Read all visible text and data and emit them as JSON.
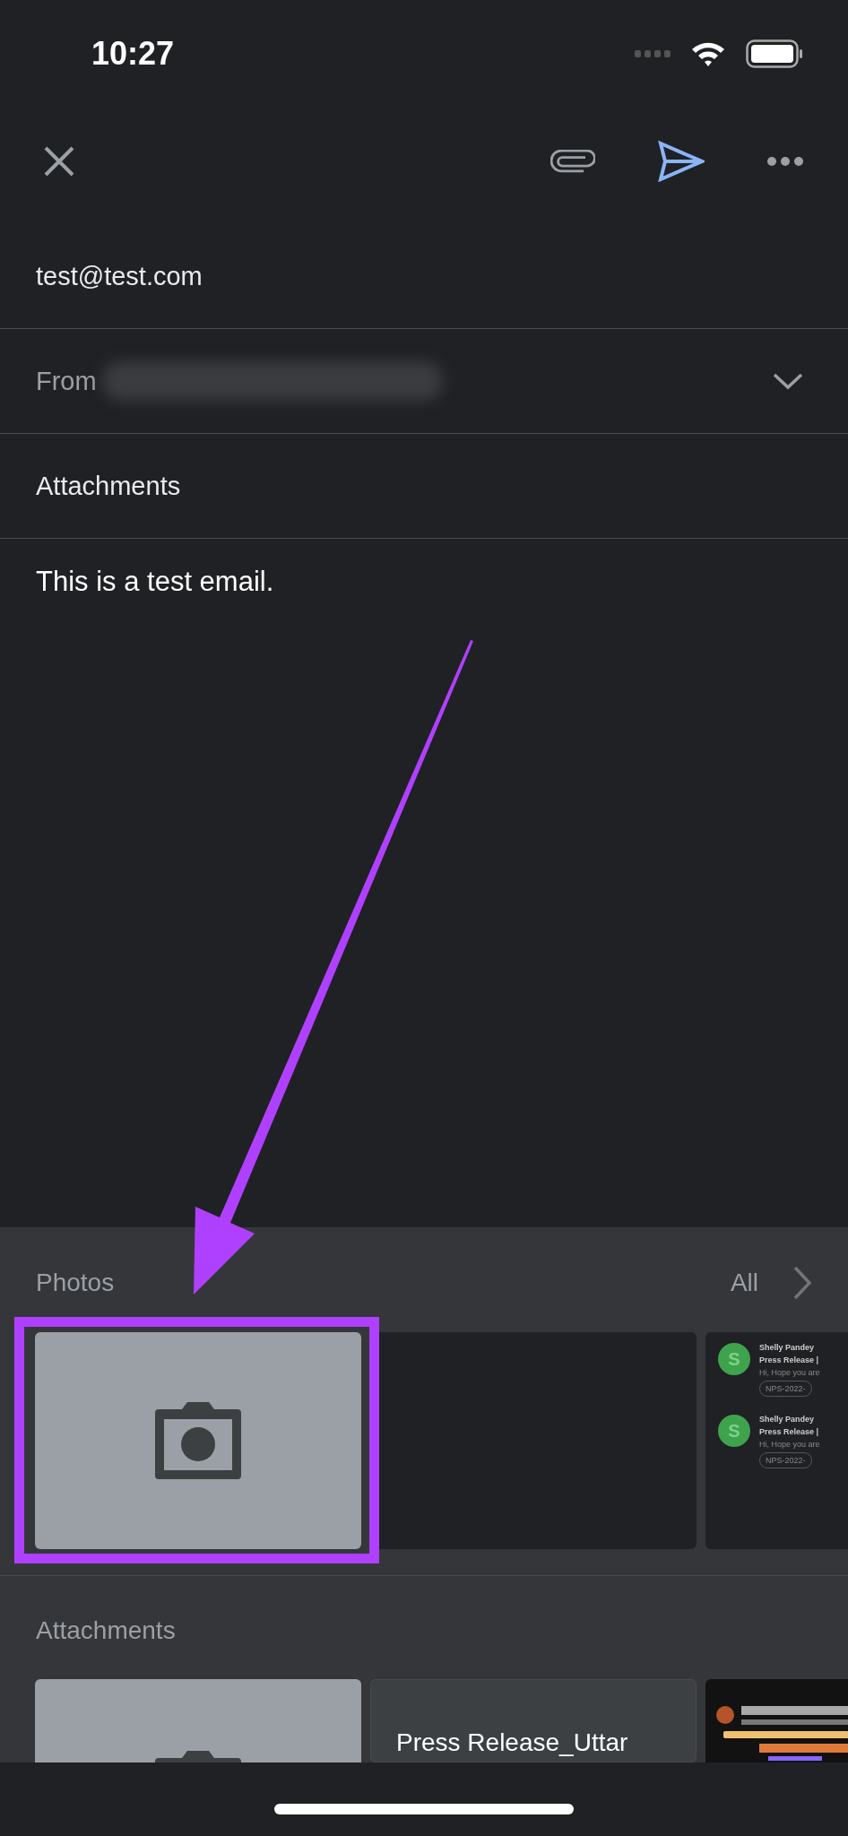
{
  "status_bar": {
    "time": "10:27"
  },
  "to": {
    "value": "test@test.com"
  },
  "from": {
    "label": "From"
  },
  "attachments_field": {
    "label": "Attachments"
  },
  "body": {
    "text": "This is a test email."
  },
  "photos": {
    "title": "Photos",
    "all_link": "All",
    "tiles": [
      {
        "kind": "camera"
      },
      {
        "kind": "empty"
      },
      {
        "kind": "email",
        "entries": [
          {
            "avatar": "S",
            "sender": "Shelly Pandey",
            "subject": "Press Release |",
            "preview": "Hi, Hope you are",
            "attachment": "NPS-2022-"
          },
          {
            "avatar": "S",
            "sender": "Shelly Pandey",
            "subject": "Press Release |",
            "preview": "Hi, Hope you are",
            "attachment": "NPS-2022-"
          }
        ]
      }
    ]
  },
  "attachments": {
    "title": "Attachments",
    "items": [
      {
        "kind": "camera"
      },
      {
        "kind": "file",
        "name": "Press Release_Uttar"
      },
      {
        "kind": "picture"
      }
    ]
  }
}
